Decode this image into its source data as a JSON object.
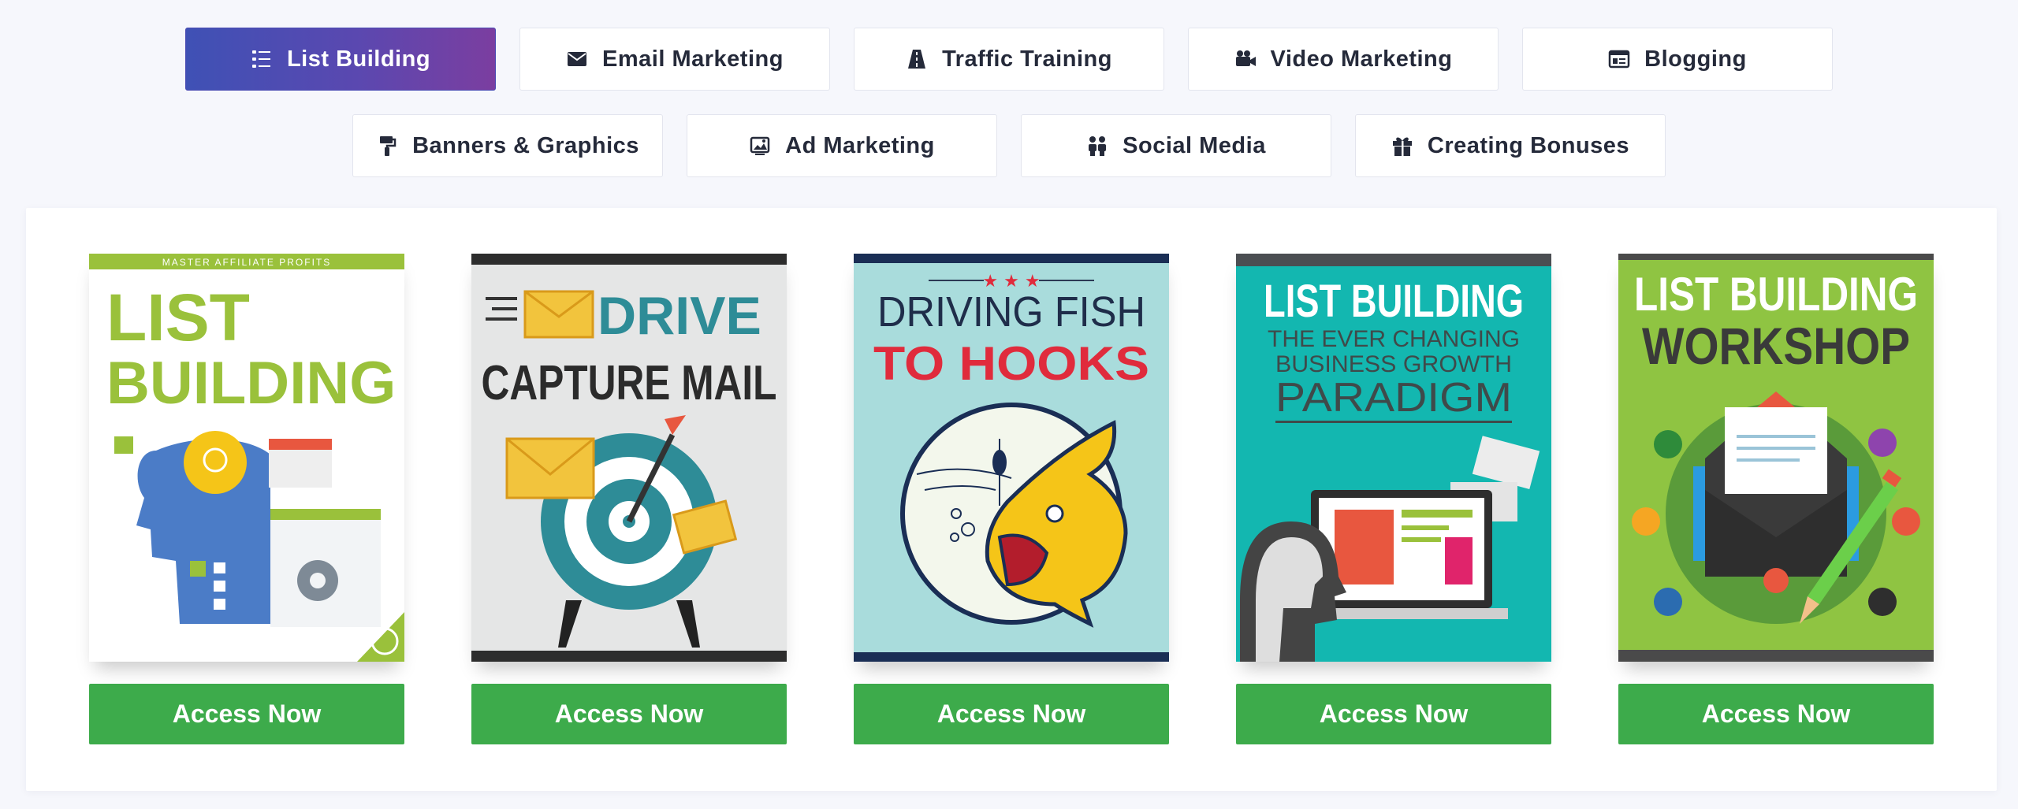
{
  "tabs_row1": [
    {
      "label": "List Building",
      "icon": "list-icon",
      "active": true
    },
    {
      "label": "Email Marketing",
      "icon": "envelope-icon",
      "active": false
    },
    {
      "label": "Traffic Training",
      "icon": "road-icon",
      "active": false
    },
    {
      "label": "Video Marketing",
      "icon": "video-camera-icon",
      "active": false
    },
    {
      "label": "Blogging",
      "icon": "browser-window-icon",
      "active": false
    }
  ],
  "tabs_row2": [
    {
      "label": "Banners & Graphics",
      "icon": "paint-roller-icon",
      "active": false
    },
    {
      "label": "Ad Marketing",
      "icon": "image-ad-icon",
      "active": false
    },
    {
      "label": "Social Media",
      "icon": "people-icon",
      "active": false
    },
    {
      "label": "Creating Bonuses",
      "icon": "gift-icon",
      "active": false
    }
  ],
  "colors": {
    "active_tab_start": "#3f51b5",
    "active_tab_end": "#7b3ea0",
    "button": "#3dab4b",
    "page_bg": "#f6f7fc"
  },
  "products": [
    {
      "cover_lines": [
        "MASTER AFFILIATE PROFITS",
        "LIST",
        "BUILDING"
      ],
      "button": "Access Now"
    },
    {
      "cover_lines": [
        "DRIVE",
        "CAPTURE MAIL"
      ],
      "button": "Access Now"
    },
    {
      "cover_lines": [
        "DRIVING FISH",
        "TO HOOKS"
      ],
      "button": "Access Now"
    },
    {
      "cover_lines": [
        "LIST BUILDING",
        "THE EVER CHANGING",
        "BUSINESS GROWTH",
        "PARADIGM"
      ],
      "button": "Access Now"
    },
    {
      "cover_lines": [
        "LIST BUILDING",
        "WORKSHOP"
      ],
      "button": "Access Now"
    }
  ]
}
